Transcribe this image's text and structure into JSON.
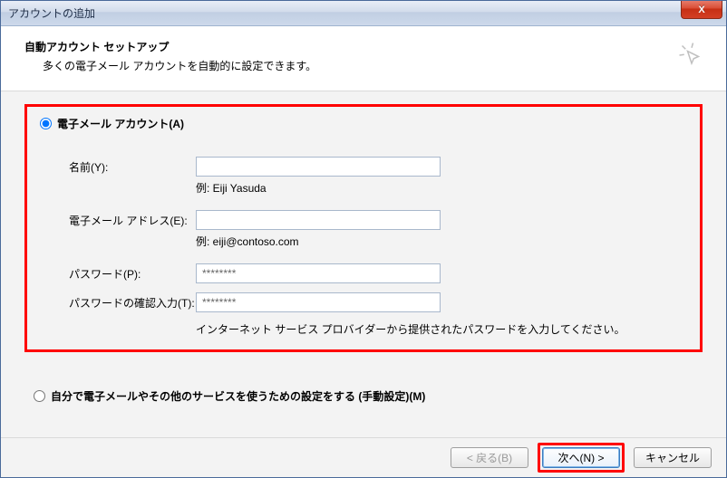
{
  "window": {
    "title": "アカウントの追加",
    "close_glyph": "X"
  },
  "header": {
    "heading": "自動アカウント セットアップ",
    "subheading": "多くの電子メール アカウントを自動的に設定できます。"
  },
  "radio": {
    "email_account_label": "電子メール アカウント(A)",
    "manual_label": "自分で電子メールやその他のサービスを使うための設定をする (手動設定)(M)"
  },
  "form": {
    "name_label": "名前(Y):",
    "name_value": "　　　　",
    "name_hint": "例: Eiji Yasuda",
    "email_label": "電子メール アドレス(E):",
    "email_value": "　　　　　　　　　　",
    "email_hint": "例: eiji@contoso.com",
    "password_label": "パスワード(P):",
    "password_value": "********",
    "password2_label": "パスワードの確認入力(T):",
    "password2_value": "********",
    "password_hint": "インターネット サービス プロバイダーから提供されたパスワードを入力してください。"
  },
  "buttons": {
    "back": "< 戻る(B)",
    "next": "次へ(N) >",
    "cancel": "キャンセル"
  }
}
